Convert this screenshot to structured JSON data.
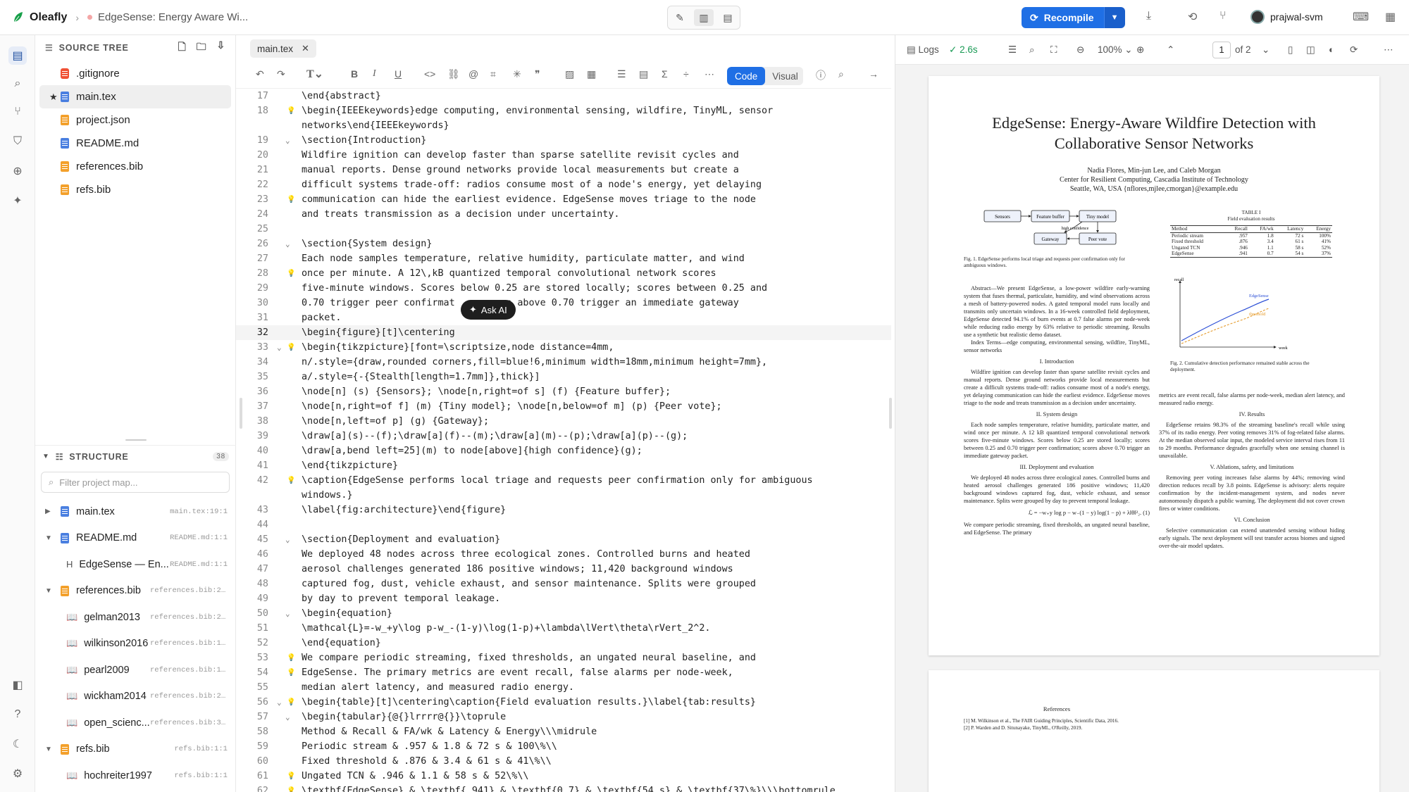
{
  "app": {
    "name": "Oleafly",
    "doc_title": "EdgeSense: Energy Aware Wi..."
  },
  "topbar": {
    "recompile_label": "Recompile",
    "user_name": "prajwal-svm"
  },
  "sidebar": {
    "source_tree_title": "SOURCE TREE",
    "files": [
      {
        "name": ".gitignore",
        "icon": "git-icon"
      },
      {
        "name": "main.tex",
        "icon": "file-icon",
        "starred": true
      },
      {
        "name": "project.json",
        "icon": "file-icon"
      },
      {
        "name": "README.md",
        "icon": "file-icon"
      },
      {
        "name": "references.bib",
        "icon": "file-icon"
      },
      {
        "name": "refs.bib",
        "icon": "file-icon"
      }
    ],
    "structure_title": "STRUCTURE",
    "structure_count": "38",
    "filter_placeholder": "Filter project map...",
    "structure": [
      {
        "label": "main.tex",
        "loc": "main.tex:19:1"
      },
      {
        "label": "README.md",
        "loc": "README.md:1:1"
      },
      {
        "label": "EdgeSense — En...",
        "loc": "README.md:1:1",
        "prefix": "H"
      },
      {
        "label": "references.bib",
        "loc": "references.bib:2:1"
      },
      {
        "label": "gelman2013",
        "loc": "references.bib:2:1"
      },
      {
        "label": "wilkinson2016",
        "loc": "references.bib:11..."
      },
      {
        "label": "pearl2009",
        "loc": "references.bib:19..."
      },
      {
        "label": "wickham2014",
        "loc": "references.bib:26..."
      },
      {
        "label": "open_scienc...",
        "loc": "references.bib:35..."
      },
      {
        "label": "refs.bib",
        "loc": "refs.bib:1:1"
      },
      {
        "label": "hochreiter1997",
        "loc": "refs.bib:1:1"
      }
    ]
  },
  "editor": {
    "tab_name": "main.tex",
    "mode_code": "Code",
    "mode_visual": "Visual",
    "ask_ai": "Ask AI",
    "lines": [
      {
        "n": "17",
        "t": "\\end{abstract}"
      },
      {
        "n": "18",
        "t": "\\begin{IEEEkeywords}edge computing, environmental sensing, wildfire, TinyML, sensor",
        "bulb": true
      },
      {
        "n": "",
        "t": "networks\\end{IEEEkeywords}"
      },
      {
        "n": "19",
        "t": "\\section{Introduction}",
        "fold": true
      },
      {
        "n": "20",
        "t": "Wildfire ignition can develop faster than sparse satellite revisit cycles and"
      },
      {
        "n": "21",
        "t": "manual reports. Dense ground networks provide local measurements but create a"
      },
      {
        "n": "22",
        "t": "difficult systems trade-off: radios consume most of a node's energy, yet delaying"
      },
      {
        "n": "23",
        "t": "communication can hide the earliest evidence. EdgeSense moves triage to the node",
        "bulb": true
      },
      {
        "n": "24",
        "t": "and treats transmission as a decision under uncertainty."
      },
      {
        "n": "25",
        "t": ""
      },
      {
        "n": "26",
        "t": "\\section{System design}",
        "fold": true
      },
      {
        "n": "27",
        "t": "Each node samples temperature, relative humidity, particulate matter, and wind"
      },
      {
        "n": "28",
        "t": "once per minute. A 12\\,kB quantized temporal convolutional network scores",
        "bulb": true
      },
      {
        "n": "29",
        "t": "five-minute windows. Scores below 0.25 are stored locally; scores between 0.25 and"
      },
      {
        "n": "30",
        "t": "0.70 trigger peer confirmat        es above 0.70 trigger an immediate gateway"
      },
      {
        "n": "31",
        "t": "packet."
      },
      {
        "n": "32",
        "t": "\\begin{figure}[t]\\centering",
        "cur": true
      },
      {
        "n": "33",
        "t": "\\begin{tikzpicture}[font=\\scriptsize,node distance=4mm,",
        "bulb": true,
        "fold": true
      },
      {
        "n": "34",
        "t": "n/.style={draw,rounded corners,fill=blue!6,minimum width=18mm,minimum height=7mm},"
      },
      {
        "n": "35",
        "t": "a/.style={-{Stealth[length=1.7mm]},thick}]"
      },
      {
        "n": "36",
        "t": "\\node[n] (s) {Sensors}; \\node[n,right=of s] (f) {Feature buffer};"
      },
      {
        "n": "37",
        "t": "\\node[n,right=of f] (m) {Tiny model}; \\node[n,below=of m] (p) {Peer vote};"
      },
      {
        "n": "38",
        "t": "\\node[n,left=of p] (g) {Gateway};"
      },
      {
        "n": "39",
        "t": "\\draw[a](s)--(f);\\draw[a](f)--(m);\\draw[a](m)--(p);\\draw[a](p)--(g);"
      },
      {
        "n": "40",
        "t": "\\draw[a,bend left=25](m) to node[above]{high confidence}(g);"
      },
      {
        "n": "41",
        "t": "\\end{tikzpicture}"
      },
      {
        "n": "42",
        "t": "\\caption{EdgeSense performs local triage and requests peer confirmation only for ambiguous",
        "bulb": true
      },
      {
        "n": "",
        "t": "windows.}"
      },
      {
        "n": "43",
        "t": "\\label{fig:architecture}\\end{figure}"
      },
      {
        "n": "44",
        "t": ""
      },
      {
        "n": "45",
        "t": "\\section{Deployment and evaluation}",
        "fold": true
      },
      {
        "n": "46",
        "t": "We deployed 48 nodes across three ecological zones. Controlled burns and heated"
      },
      {
        "n": "47",
        "t": "aerosol challenges generated 186 positive windows; 11,420 background windows"
      },
      {
        "n": "48",
        "t": "captured fog, dust, vehicle exhaust, and sensor maintenance. Splits were grouped"
      },
      {
        "n": "49",
        "t": "by day to prevent temporal leakage."
      },
      {
        "n": "50",
        "t": "\\begin{equation}",
        "fold": true
      },
      {
        "n": "51",
        "t": "\\mathcal{L}=-w_+y\\log p-w_-(1-y)\\log(1-p)+\\lambda\\lVert\\theta\\rVert_2^2."
      },
      {
        "n": "52",
        "t": "\\end{equation}"
      },
      {
        "n": "53",
        "t": "We compare periodic streaming, fixed thresholds, an ungated neural baseline, and",
        "bulb": true
      },
      {
        "n": "54",
        "t": "EdgeSense. The primary metrics are event recall, false alarms per node-week,",
        "bulb": true
      },
      {
        "n": "55",
        "t": "median alert latency, and measured radio energy."
      },
      {
        "n": "56",
        "t": "\\begin{table}[t]\\centering\\caption{Field evaluation results.}\\label{tab:results}",
        "bulb": true,
        "fold": true
      },
      {
        "n": "57",
        "t": "\\begin{tabular}{@{}lrrrr@{}}\\toprule",
        "fold": true
      },
      {
        "n": "58",
        "t": "Method & Recall & FA/wk & Latency & Energy\\\\\\midrule"
      },
      {
        "n": "59",
        "t": "Periodic stream & .957 & 1.8 & 72 s & 100\\%\\\\"
      },
      {
        "n": "60",
        "t": "Fixed threshold & .876 & 3.4 & 61 s & 41\\%\\\\"
      },
      {
        "n": "61",
        "t": "Ungated TCN & .946 & 1.1 & 58 s & 52\\%\\\\",
        "bulb": true
      },
      {
        "n": "62",
        "t": "\\textbf{EdgeSense} & \\textbf{.941} & \\textbf{0.7} & \\textbf{54 s} & \\textbf{37\\%}\\\\\\bottomrule",
        "bulb": true
      }
    ]
  },
  "pdf": {
    "logs_label": "Logs",
    "compile_time": "2.6s",
    "zoom": "100%",
    "page_current": "1",
    "page_total": "of 2",
    "title": "EdgeSense: Energy-Aware Wildfire Detection with Collaborative Sensor Networks",
    "authors": "Nadia Flores, Min-jun Lee, and Caleb Morgan",
    "affiliation": "Center for Resilient Computing, Cascadia Institute of Technology",
    "address": "Seattle, WA, USA     {nflores,mjlee,cmorgan}@example.edu",
    "fig1_nodes": [
      "Sensors",
      "Feature buffer",
      "Tiny model",
      "Gateway",
      "Peer vote"
    ],
    "fig1_edge": "high confidence",
    "fig1_caption": "Fig. 1.  EdgeSense performs local triage and requests peer confirmation only for ambiguous windows.",
    "table_title": "TABLE I",
    "table_caption": "Field evaluation results",
    "table_head": [
      "Method",
      "Recall",
      "FA/wk",
      "Latency",
      "Energy"
    ],
    "table_rows": [
      [
        "Periodic stream",
        ".957",
        "1.8",
        "72 s",
        "100%"
      ],
      [
        "Fixed threshold",
        ".876",
        "3.4",
        "61 s",
        "41%"
      ],
      [
        "Ungated TCN",
        ".946",
        "1.1",
        "58 s",
        "52%"
      ],
      [
        "EdgeSense",
        ".941",
        "0.7",
        "54 s",
        "37%"
      ]
    ],
    "fig2_ylabel": "recall",
    "fig2_xlabel": "week",
    "fig2_series": [
      "EdgeSense",
      "threshold"
    ],
    "fig2_caption": "Fig. 2.  Cumulative detection performance remained stable across the deployment.",
    "abstract": "Abstract—We present EdgeSense, a low-power wildfire early-warning system that fuses thermal, particulate, humidity, and wind observations across a mesh of battery-powered nodes. A gated temporal model runs locally and transmits only uncertain windows. In a 16-week controlled field deployment, EdgeSense detected 94.1% of burn events at 0.7 false alarms per node-week while reducing radio energy by 63% relative to periodic streaming. Results use a synthetic but realistic demo dataset.",
    "index_terms": "Index Terms—edge computing, environmental sensing, wildfire, TinyML, sensor networks",
    "s1_head": "I. Introduction",
    "s1_text": "Wildfire ignition can develop faster than sparse satellite revisit cycles and manual reports. Dense ground networks provide local measurements but create a difficult systems trade-off: radios consume most of a node's energy, yet delaying communication can hide the earliest evidence. EdgeSense moves triage to the node and treats transmission as a decision under uncertainty.",
    "s2_head": "II. System design",
    "s2_text": "Each node samples temperature, relative humidity, particulate matter, and wind once per minute. A 12 kB quantized temporal convolutional network scores five-minute windows. Scores below 0.25 are stored locally; scores between 0.25 and 0.70 trigger peer confirmation; scores above 0.70 trigger an immediate gateway packet.",
    "s3_head": "III. Deployment and evaluation",
    "s3_text": "We deployed 48 nodes across three ecological zones. Controlled burns and heated aerosol challenges generated 186 positive windows; 11,420 background windows captured fog, dust, vehicle exhaust, and sensor maintenance. Splits were grouped by day to prevent temporal leakage.",
    "equation": "ℒ = −w₊y log p − w₋(1 − y) log(1 − p) + λ‖θ‖²₂.     (1)",
    "s3_text2": "We compare periodic streaming, fixed thresholds, an ungated neural baseline, and EdgeSense. The primary",
    "r_text0": "metrics are event recall, false alarms per node-week, median alert latency, and measured radio energy.",
    "s4_head": "IV. Results",
    "s4_text": "EdgeSense retains 98.3% of the streaming baseline's recall while using 37% of its radio energy. Peer voting removes 31% of fog-related false alarms. At the median observed solar input, the modeled service interval rises from 11 to 29 months. Performance degrades gracefully when one sensing channel is unavailable.",
    "s5_head": "V. Ablations, safety, and limitations",
    "s5_text": "Removing peer voting increases false alarms by 44%; removing wind direction reduces recall by 3.8 points. EdgeSense is advisory: alerts require confirmation by the incident-management system, and nodes never autonomously dispatch a public warning. The deployment did not cover crown fires or winter conditions.",
    "s6_head": "VI. Conclusion",
    "s6_text": "Selective communication can extend unattended sensing without hiding early signals. The next deployment will test transfer across biomes and signed over-the-air model updates.",
    "refs_head": "References",
    "refs": [
      "[1]  M. Wilkinson et al., The FAIR Guiding Principles, Scientific Data, 2016.",
      "[2]  P. Warden and D. Situnayake, TinyML, O'Reilly, 2019."
    ]
  }
}
